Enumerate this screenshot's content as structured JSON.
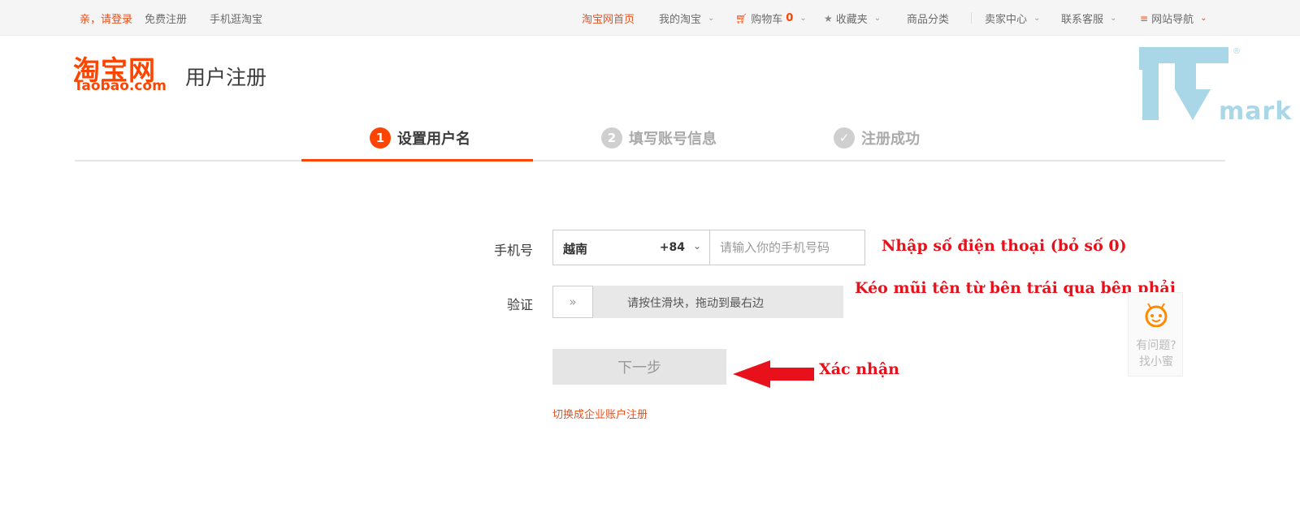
{
  "topbar": {
    "greeting": "亲，请登录",
    "register": "免费注册",
    "mobile": "手机逛淘宝",
    "home": "淘宝网首页",
    "my_taobao": "我的淘宝",
    "cart_label": "购物车",
    "cart_count": "0",
    "favorites": "收藏夹",
    "categories": "商品分类",
    "seller_center": "卖家中心",
    "service": "联系客服",
    "site_nav": "网站导航"
  },
  "header": {
    "logo_cn": "淘宝网",
    "logo_en": "Taobao.com",
    "title": "用户注册"
  },
  "watermark": {
    "text": "mark",
    "reg": "®"
  },
  "steps": [
    {
      "num": "1",
      "label": "设置用户名",
      "active": true
    },
    {
      "num": "2",
      "label": "填写账号信息",
      "active": false
    },
    {
      "label": "注册成功",
      "active": false
    }
  ],
  "form": {
    "phone_label": "手机号",
    "country_name": "越南",
    "country_code": "+84",
    "phone_placeholder": "请输入你的手机号码",
    "verify_label": "验证",
    "slider_text": "请按住滑块，拖动到最右边",
    "next_button": "下一步",
    "switch_link": "切换成企业账户注册"
  },
  "annotations": {
    "phone_hint": "Nhập số điện thoại (bỏ số 0)",
    "slider_hint": "Kéo mũi tên từ bên trái qua bên phải",
    "confirm_hint": "Xác nhận"
  },
  "help": {
    "line1": "有问题?",
    "line2": "找小蜜"
  },
  "colors": {
    "brand": "#ff4400",
    "annotation": "#e8101a",
    "watermark": "#a9d7e8"
  }
}
